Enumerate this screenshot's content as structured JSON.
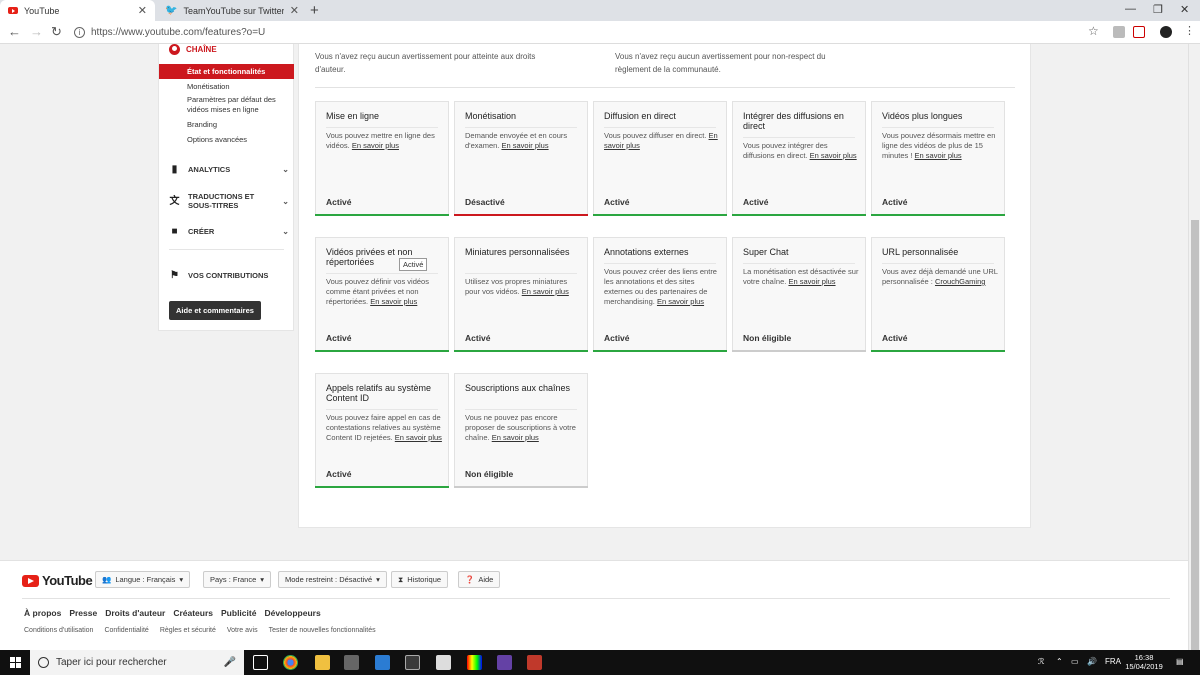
{
  "browser": {
    "tabs": [
      {
        "title": "YouTube"
      },
      {
        "title": "TeamYouTube sur Twitter : \"Merc"
      }
    ],
    "url": "https://www.youtube.com/features?o=U"
  },
  "nav": {
    "channel": "CHAÎNE",
    "selected": "État et fonctionnalités",
    "subitems": [
      "Monétisation",
      "Paramètres par défaut des vidéos mises en ligne",
      "Branding",
      "Options avancées"
    ],
    "sections": [
      {
        "label": "ANALYTICS",
        "icon": "bar-chart-icon"
      },
      {
        "label": "TRADUCTIONS ET SOUS-TITRES",
        "icon": "translate-icon"
      },
      {
        "label": "CRÉER",
        "icon": "camera-icon"
      },
      {
        "label": "VOS CONTRIBUTIONS",
        "icon": "contributions-icon"
      }
    ],
    "feedback": "Aide et commentaires"
  },
  "warnings": {
    "copyright": "Vous n'avez reçu aucun avertissement pour atteinte aux droits d'auteur.",
    "community": "Vous n'avez reçu aucun avertissement pour non-respect du règlement de la communauté."
  },
  "features": [
    {
      "title": "Mise en ligne",
      "desc": "Vous pouvez mettre en ligne des vidéos.",
      "link": "En savoir plus",
      "status": "Activé",
      "state": "on"
    },
    {
      "title": "Monétisation",
      "desc": "Demande envoyée et en cours d'examen.",
      "link": "En savoir plus",
      "status": "Désactivé",
      "state": "off"
    },
    {
      "title": "Diffusion en direct",
      "desc": "Vous pouvez diffuser en direct.",
      "link": "En savoir plus",
      "status": "Activé",
      "state": "on"
    },
    {
      "title": "Intégrer des diffusions en direct",
      "desc": "Vous pouvez intégrer des diffusions en direct.",
      "link": "En savoir plus",
      "status": "Activé",
      "state": "on"
    },
    {
      "title": "Vidéos plus longues",
      "desc": "Vous pouvez désormais mettre en ligne des vidéos de plus de 15 minutes !",
      "link": "En savoir plus",
      "status": "Activé",
      "state": "on"
    },
    {
      "title": "Vidéos privées et non répertoriées",
      "desc": "Vous pouvez définir vos vidéos comme étant privées et non répertoriées.",
      "link": "En savoir plus",
      "status": "Activé",
      "state": "on"
    },
    {
      "title": "Miniatures personnalisées",
      "desc": "Utilisez vos propres miniatures pour vos vidéos.",
      "link": "En savoir plus",
      "status": "Activé",
      "state": "on"
    },
    {
      "title": "Annotations externes",
      "desc": "Vous pouvez créer des liens entre les annotations et des sites externes ou des partenaires de merchandising.",
      "link": "En savoir plus",
      "status": "Activé",
      "state": "on"
    },
    {
      "title": "Super Chat",
      "desc": "La monétisation est désactivée sur votre chaîne.",
      "link": "En savoir plus",
      "status": "Non éligible",
      "state": "na"
    },
    {
      "title": "URL personnalisée",
      "desc": "Vous avez déjà demandé une URL personnalisée :",
      "link": "CrouchGaming",
      "status": "Activé",
      "state": "on"
    },
    {
      "title": "Appels relatifs au système Content ID",
      "desc": "Vous pouvez faire appel en cas de contestations relatives au système Content ID rejetées.",
      "link": "En savoir plus",
      "status": "Activé",
      "state": "on"
    },
    {
      "title": "Souscriptions aux chaînes",
      "desc": "Vous ne pouvez pas encore proposer de souscriptions à votre chaîne.",
      "link": "En savoir plus",
      "status": "Non éligible",
      "state": "na"
    }
  ],
  "tooltip": "Activé",
  "colors": {
    "on": "#2ba640",
    "off": "#cc181e",
    "na": "#cccccc"
  },
  "footer": {
    "logo": "YouTube",
    "language": "Langue : Français",
    "country": "Pays : France",
    "restricted": "Mode restreint : Désactivé",
    "history": "Historique",
    "help": "Aide",
    "links": [
      "À propos",
      "Presse",
      "Droits d'auteur",
      "Créateurs",
      "Publicité",
      "Développeurs"
    ],
    "sublinks": [
      "Conditions d'utilisation",
      "Confidentialité",
      "Règles et sécurité",
      "Votre avis",
      "Tester de nouvelles fonctionnalités"
    ]
  },
  "taskbar": {
    "search": "Taper ici pour rechercher",
    "lang": "FRA",
    "time": "16:38",
    "date": "15/04/2019"
  }
}
